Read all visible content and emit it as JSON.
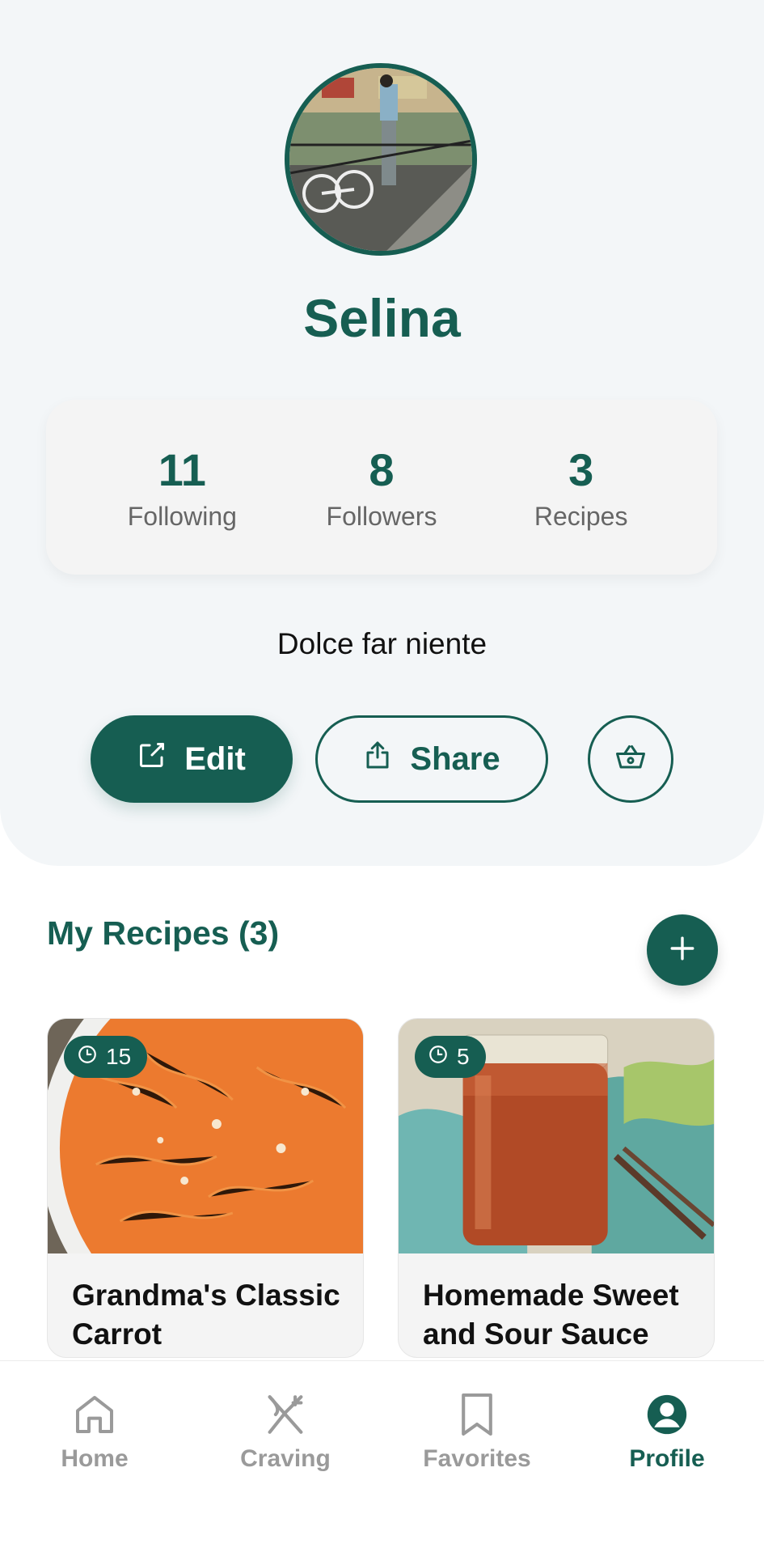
{
  "profile": {
    "name": "Selina",
    "bio": "Dolce far niente",
    "stats": [
      {
        "value": "11",
        "label": "Following"
      },
      {
        "value": "8",
        "label": "Followers"
      },
      {
        "value": "3",
        "label": "Recipes"
      }
    ],
    "buttons": {
      "edit": "Edit",
      "share": "Share"
    }
  },
  "recipes": {
    "title": "My Recipes (3)",
    "items": [
      {
        "time": "15",
        "title": "Grandma's Classic Carrot"
      },
      {
        "time": "5",
        "title": "Homemade Sweet and Sour Sauce"
      }
    ]
  },
  "nav": {
    "items": [
      {
        "label": "Home",
        "icon": "home-icon"
      },
      {
        "label": "Craving",
        "icon": "fork-knife-icon"
      },
      {
        "label": "Favorites",
        "icon": "bookmark-icon"
      },
      {
        "label": "Profile",
        "icon": "profile-icon"
      }
    ],
    "active": "Profile"
  },
  "colors": {
    "accent": "#165e52",
    "muted": "#9a9a9a"
  }
}
